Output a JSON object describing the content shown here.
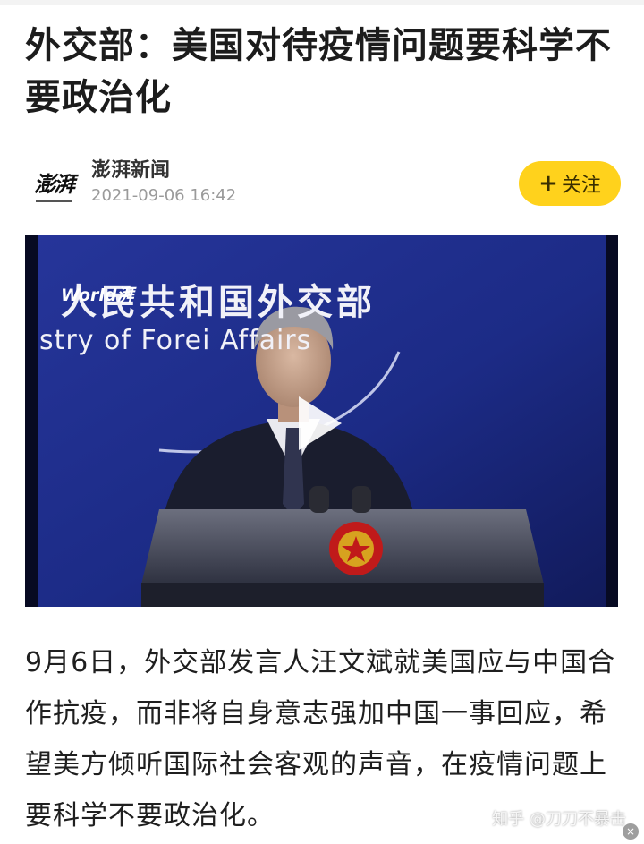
{
  "article": {
    "title": "外交部：美国对待疫情问题要科学不要政治化",
    "author": {
      "name": "澎湃新闻",
      "published": "2021-09-06 16:42",
      "avatar_text": "澎湃"
    },
    "follow_button": {
      "plus": "+",
      "label": "关注"
    },
    "video": {
      "backdrop_cn": "人民共和国外交部",
      "backdrop_en": "stry of Forei  Affairs",
      "watermark": "World湃",
      "play_icon": "play-icon"
    },
    "body": "9月6日，外交部发言人汪文斌就美国应与中国合作抗疫，而非将自身意志强加中国一事回应，希望美方倾听国际社会客观的声音，在疫情问题上要科学不要政治化。"
  },
  "overlay": {
    "site_watermark": "知乎 @刀刀不暴击",
    "close_symbol": "×"
  },
  "colors": {
    "follow_button": "#ffd21c",
    "video_background": "#0a1036",
    "title": "#1c1c1c"
  }
}
